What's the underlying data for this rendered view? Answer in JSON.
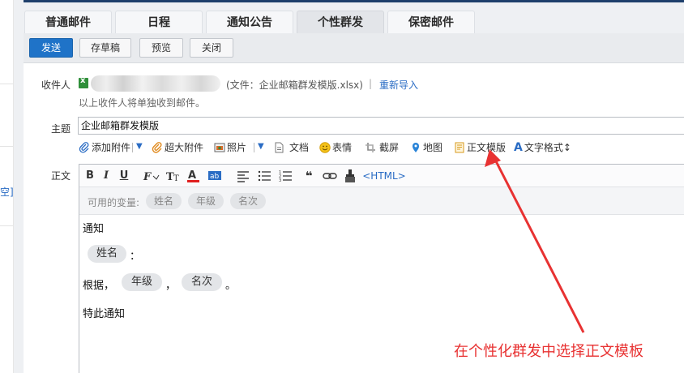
{
  "sidebar": {
    "clipped_text": "空]"
  },
  "tabs": [
    {
      "label": "普通邮件",
      "active": false
    },
    {
      "label": "日程",
      "active": false
    },
    {
      "label": "通知公告",
      "active": false
    },
    {
      "label": "个性群发",
      "active": true
    },
    {
      "label": "保密邮件",
      "active": false
    }
  ],
  "toolbar": {
    "send": "发送",
    "save_draft": "存草稿",
    "preview": "预览",
    "close": "关闭"
  },
  "recipients": {
    "label": "收件人",
    "file_info": "(文件：企业邮箱群发模版.xlsx)",
    "separator": "|",
    "reimport": "重新导入",
    "hint": "以上收件人将单独收到邮件。"
  },
  "subject": {
    "label": "主题",
    "value": "企业邮箱群发模版"
  },
  "attach_bar": {
    "add_attachment": "添加附件",
    "large_attachment": "超大附件",
    "photo": "照片",
    "document": "文档",
    "emoji": "表情",
    "screenshot": "截屏",
    "map": "地图",
    "body_template": "正文模版",
    "text_format": "文字格式",
    "text_format_arrow": "↕"
  },
  "body": {
    "label": "正文",
    "format": {
      "bold": "B",
      "italic": "I",
      "underline": "U",
      "quote": "❝",
      "html": "<HTML>"
    },
    "variables_label": "可用的变量:",
    "variables": [
      "姓名",
      "年级",
      "名次"
    ],
    "lines": {
      "notice": "通知",
      "colon": "：",
      "according": "根据，",
      "comma": "，",
      "period": "。",
      "ending": "特此通知"
    }
  },
  "annotation": {
    "text": "在个性化群发中选择正文模板",
    "color": "#e83232"
  },
  "colors": {
    "primary_button": "#1f73c8",
    "link": "#2a6cc4",
    "header": "#1e3f6b"
  }
}
